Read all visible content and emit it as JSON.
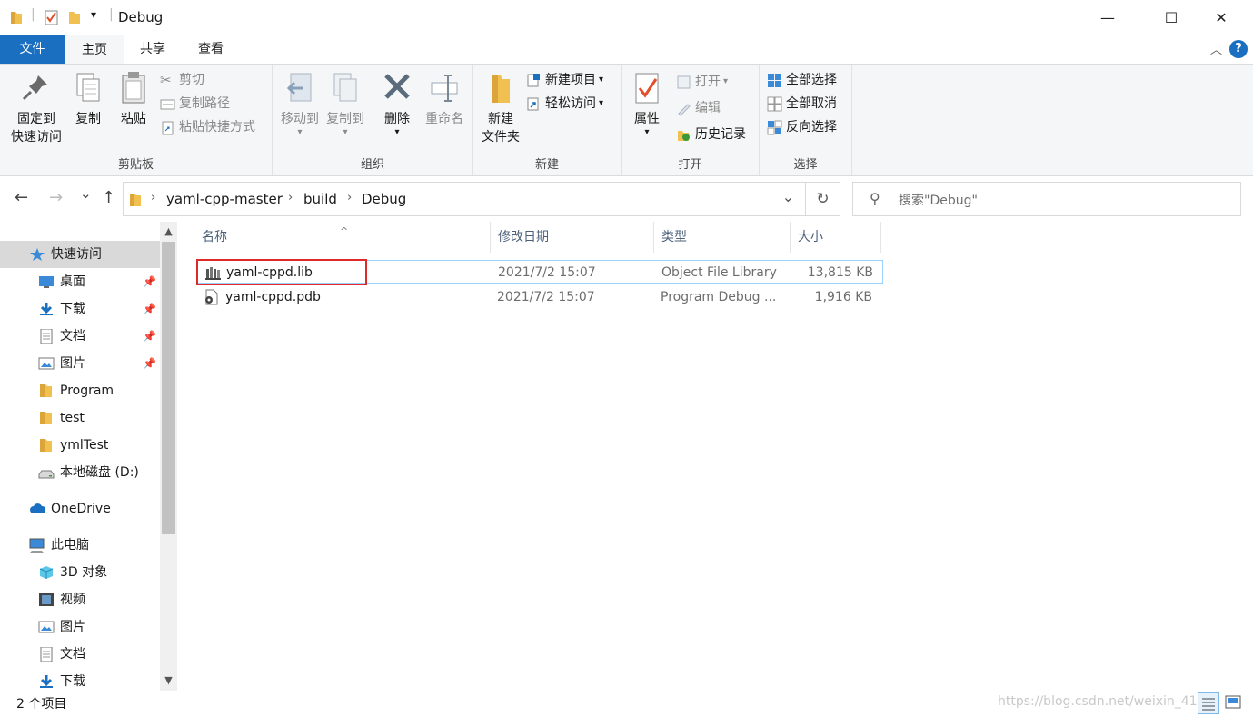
{
  "window": {
    "title": "Debug",
    "minimize_glyph": "—",
    "maximize_glyph": "☐",
    "close_glyph": "✕",
    "qat_dropdown_glyph": "▾"
  },
  "tabs": {
    "file": "文件",
    "home": "主页",
    "share": "共享",
    "view": "查看",
    "collapse_glyph": "︿",
    "help_glyph": "?"
  },
  "ribbon": {
    "clipboard": {
      "label": "剪贴板",
      "pin_line1": "固定到",
      "pin_line2": "快速访问",
      "copy": "复制",
      "paste": "粘贴",
      "cut": "剪切",
      "copy_path": "复制路径",
      "paste_shortcut": "粘贴快捷方式"
    },
    "organize": {
      "label": "组织",
      "move_to": "移动到",
      "copy_to": "复制到",
      "delete": "删除",
      "rename": "重命名"
    },
    "new": {
      "label": "新建",
      "new_folder_line1": "新建",
      "new_folder_line2": "文件夹",
      "new_item": "新建项目",
      "easy_access": "轻松访问"
    },
    "open": {
      "label": "打开",
      "properties": "属性",
      "open": "打开",
      "edit": "编辑",
      "history": "历史记录"
    },
    "select": {
      "label": "选择",
      "select_all": "全部选择",
      "select_none": "全部取消",
      "invert": "反向选择"
    },
    "dropdown_glyph": "▾"
  },
  "nav": {
    "back_glyph": "←",
    "forward_glyph": "→",
    "recent_glyph": "⌄",
    "up_glyph": "↑",
    "breadcrumb": [
      "yaml-cpp-master",
      "build",
      "Debug"
    ],
    "separator_glyph": "›",
    "address_dropdown_glyph": "⌄",
    "refresh_glyph": "↻",
    "search_placeholder": "搜索\"Debug\"",
    "search_glyph": "⚲"
  },
  "sidebar": {
    "pin_glyph": "📌",
    "scroll_up_glyph": "▲",
    "scroll_down_glyph": "▼",
    "items": [
      {
        "label": "快速访问",
        "icon": "star-icon"
      },
      {
        "label": "桌面",
        "icon": "desktop-icon"
      },
      {
        "label": "下载",
        "icon": "download-icon"
      },
      {
        "label": "文档",
        "icon": "document-icon"
      },
      {
        "label": "图片",
        "icon": "picture-icon"
      },
      {
        "label": "Program",
        "icon": "folder-icon"
      },
      {
        "label": "test",
        "icon": "folder-icon"
      },
      {
        "label": "ymlTest",
        "icon": "folder-icon"
      },
      {
        "label": "本地磁盘 (D:)",
        "icon": "drive-icon"
      },
      {
        "label": "OneDrive",
        "icon": "cloud-icon"
      },
      {
        "label": "此电脑",
        "icon": "computer-icon"
      },
      {
        "label": "3D 对象",
        "icon": "cube-icon"
      },
      {
        "label": "视频",
        "icon": "video-icon"
      },
      {
        "label": "图片",
        "icon": "picture-icon"
      },
      {
        "label": "文档",
        "icon": "document-icon"
      },
      {
        "label": "下载",
        "icon": "download-icon"
      }
    ]
  },
  "filelist": {
    "columns": {
      "name": "名称",
      "modified": "修改日期",
      "type": "类型",
      "size": "大小"
    },
    "sort_glyph": "^",
    "rows": [
      {
        "name": "yaml-cppd.lib",
        "modified": "2021/7/2 15:07",
        "type": "Object File Library",
        "size": "13,815 KB"
      },
      {
        "name": "yaml-cppd.pdb",
        "modified": "2021/7/2 15:07",
        "type": "Program Debug ...",
        "size": "1,916 KB"
      }
    ]
  },
  "status": {
    "item_count": "2 个项目",
    "watermark": "https://blog.csdn.net/weixin_41"
  },
  "colors": {
    "accent": "#1a6fc1",
    "highlight": "#e02a2a",
    "folder": "#f0c050"
  }
}
